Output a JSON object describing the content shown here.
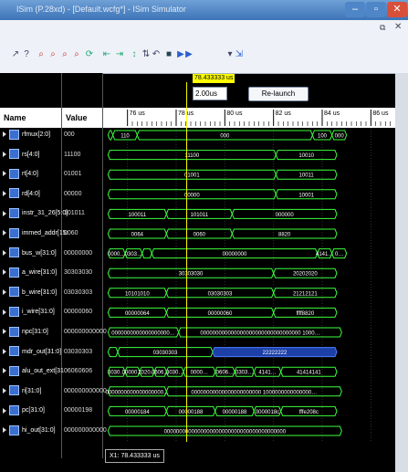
{
  "window": {
    "title": "ISim (P.28xd) - [Default.wcfg*] - ISim Simulator"
  },
  "toolbar": {
    "time_value": "2.00us",
    "relaunch_label": "Re-launch"
  },
  "table": {
    "name_header": "Name",
    "value_header": "Value"
  },
  "cursor": {
    "label": "78.433333 us"
  },
  "timeline": {
    "ticks": [
      "76 us",
      "78 us",
      "80 us",
      "82 us",
      "84 us",
      "86 us"
    ]
  },
  "signals": [
    {
      "name": "rfmux[2:0]",
      "value": "000"
    },
    {
      "name": "rs[4:0]",
      "value": "11100"
    },
    {
      "name": "rt[4:0]",
      "value": "01001"
    },
    {
      "name": "rd[4:0]",
      "value": "00000"
    },
    {
      "name": "instr_31_26[5:0]",
      "value": "101011"
    },
    {
      "name": "immed_addr[15:",
      "value": "0060"
    },
    {
      "name": "bus_w[31:0]",
      "value": "00000000"
    },
    {
      "name": "a_wire[31:0]",
      "value": "30303030"
    },
    {
      "name": "b_wire[31:0]",
      "value": "03030303"
    },
    {
      "name": "i_wire[31:0]",
      "value": "00000060"
    },
    {
      "name": "npc[31:0]",
      "value": "000000000000"
    },
    {
      "name": "mdr_out[31:0]",
      "value": "03030303"
    },
    {
      "name": "alu_out_ext[31",
      "value": "06060606"
    },
    {
      "name": "ri[31:0]",
      "value": "000000000000"
    },
    {
      "name": "pc[31:0]",
      "value": "00000198"
    },
    {
      "name": "hi_out[31:0]",
      "value": "000000000000"
    }
  ],
  "waveforms": [
    [
      {
        "t": 75.2,
        "v": ""
      },
      {
        "t": 75.4,
        "v": "110"
      },
      {
        "t": 76.4,
        "v": "000"
      },
      {
        "t": 83.6,
        "v": "100"
      },
      {
        "t": 84.4,
        "v": "000"
      },
      {
        "t": 85.0,
        "v": ""
      }
    ],
    [
      {
        "t": 75.2,
        "v": "11100"
      },
      {
        "t": 82.1,
        "v": "10010"
      },
      {
        "t": 84.6,
        "v": ""
      }
    ],
    [
      {
        "t": 75.2,
        "v": "01001"
      },
      {
        "t": 82.1,
        "v": "10011"
      },
      {
        "t": 84.6,
        "v": ""
      }
    ],
    [
      {
        "t": 75.2,
        "v": "00000"
      },
      {
        "t": 82.1,
        "v": "10001"
      },
      {
        "t": 84.6,
        "v": ""
      }
    ],
    [
      {
        "t": 75.2,
        "v": "100011"
      },
      {
        "t": 77.6,
        "v": "101011"
      },
      {
        "t": 80.3,
        "v": "000000"
      },
      {
        "t": 84.6,
        "v": ""
      }
    ],
    [
      {
        "t": 75.2,
        "v": "0064"
      },
      {
        "t": 77.6,
        "v": "0060"
      },
      {
        "t": 80.3,
        "v": "8820"
      },
      {
        "t": 84.6,
        "v": ""
      }
    ],
    [
      {
        "t": 75.2,
        "v": "0000…"
      },
      {
        "t": 75.9,
        "v": "0303…"
      },
      {
        "t": 76.6,
        "v": ""
      },
      {
        "t": 77.0,
        "v": "00000000"
      },
      {
        "t": 83.8,
        "v": "4141…"
      },
      {
        "t": 84.4,
        "v": "0…"
      },
      {
        "t": 85.0,
        "v": ""
      }
    ],
    [
      {
        "t": 75.2,
        "v": "30303030"
      },
      {
        "t": 82.0,
        "v": "20202020"
      },
      {
        "t": 84.6,
        "v": ""
      }
    ],
    [
      {
        "t": 75.2,
        "v": "10101010"
      },
      {
        "t": 77.6,
        "v": "03030303"
      },
      {
        "t": 82.0,
        "v": "21212121"
      },
      {
        "t": 84.6,
        "v": ""
      }
    ],
    [
      {
        "t": 75.2,
        "v": "00000064"
      },
      {
        "t": 77.6,
        "v": "00000060"
      },
      {
        "t": 82.0,
        "v": "ffff8820"
      },
      {
        "t": 84.6,
        "v": ""
      }
    ],
    [
      {
        "t": 75.2,
        "v": "0000000000000000000…"
      },
      {
        "t": 78.1,
        "v": "000000000000000000000000000000000 1000…"
      },
      {
        "t": 84.8,
        "v": ""
      }
    ],
    [
      {
        "t": 75.2,
        "v": ""
      },
      {
        "t": 75.6,
        "v": "03030303"
      },
      {
        "t": 79.5,
        "v": "22222222"
      },
      {
        "t": 84.6,
        "v": ""
      }
    ],
    [
      {
        "t": 75.2,
        "v": "3030…"
      },
      {
        "t": 75.9,
        "v": "00000…"
      },
      {
        "t": 76.5,
        "v": "2020…"
      },
      {
        "t": 77.1,
        "v": "0606…"
      },
      {
        "t": 77.6,
        "v": "3030…"
      },
      {
        "t": 78.3,
        "v": "0000…"
      },
      {
        "t": 79.6,
        "v": "0606…"
      },
      {
        "t": 80.4,
        "v": "0303…"
      },
      {
        "t": 81.2,
        "v": "4141…"
      },
      {
        "t": 82.3,
        "v": "41414141"
      },
      {
        "t": 84.6,
        "v": ""
      }
    ],
    [
      {
        "t": 75.2,
        "v": "0000000000000000000…"
      },
      {
        "t": 77.6,
        "v": "00000000000000000000000 1000000000000000…"
      },
      {
        "t": 84.8,
        "v": ""
      }
    ],
    [
      {
        "t": 75.2,
        "v": "00000184"
      },
      {
        "t": 77.6,
        "v": "00000188"
      },
      {
        "t": 79.6,
        "v": "00000188"
      },
      {
        "t": 81.2,
        "v": "0000018c"
      },
      {
        "t": 82.3,
        "v": "fffe208c"
      },
      {
        "t": 84.6,
        "v": ""
      }
    ],
    [
      {
        "t": 75.2,
        "v": "0000000000000000000000000000000000000000"
      },
      {
        "t": 84.8,
        "v": ""
      }
    ]
  ],
  "status": {
    "label": "X1: 78.433333 us"
  }
}
